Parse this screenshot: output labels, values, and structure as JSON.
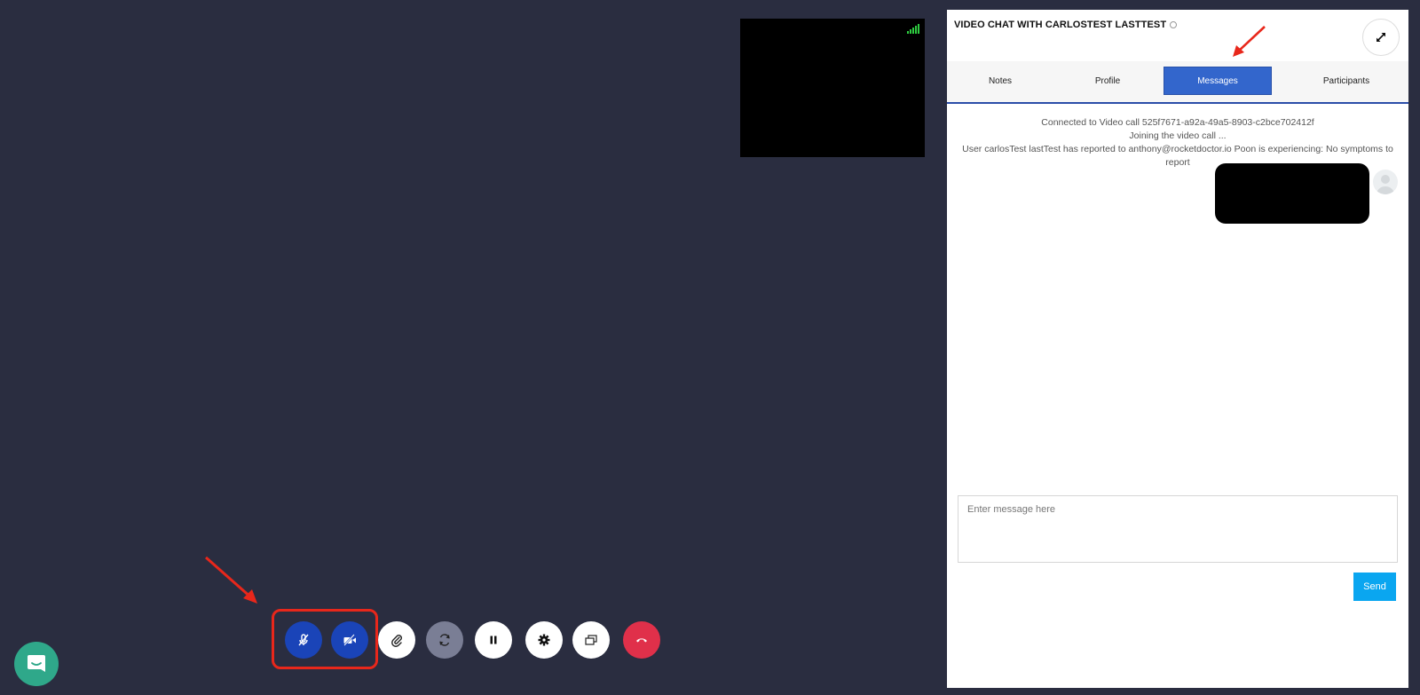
{
  "self_view": {
    "signal_icon": "signal-bars-icon"
  },
  "controls": [
    {
      "name": "mute-audio-button",
      "icon": "mic-off-icon",
      "style": "blue"
    },
    {
      "name": "mute-video-button",
      "icon": "video-off-icon",
      "style": "blue"
    },
    {
      "name": "attach-button",
      "icon": "paperclip-icon",
      "style": "white"
    },
    {
      "name": "switch-camera-button",
      "icon": "refresh-icon",
      "style": "gray"
    },
    {
      "name": "pause-button",
      "icon": "pause-icon",
      "style": "white"
    },
    {
      "name": "settings-button",
      "icon": "gear-icon",
      "style": "white"
    },
    {
      "name": "screen-share-button",
      "icon": "screen-share-icon",
      "style": "white"
    },
    {
      "name": "end-call-button",
      "icon": "phone-hangup-icon",
      "style": "red"
    }
  ],
  "panel": {
    "title": "VIDEO CHAT WITH CARLOSTEST LASTTEST",
    "tabs": [
      {
        "label": "Notes",
        "active": false
      },
      {
        "label": "Profile",
        "active": false
      },
      {
        "label": "Messages",
        "active": true
      },
      {
        "label": "Participants",
        "active": false
      }
    ],
    "messages": {
      "line1": "Connected to Video call 525f7671-a92a-49a5-8903-c2bce702412f",
      "line2": "Joining the video call ...",
      "line3": "User carlosTest lastTest has reported to anthony@rocketdoctor.io Poon is experiencing: No symptoms to report"
    },
    "input_placeholder": "Enter message here",
    "send_label": "Send"
  },
  "colors": {
    "background": "#2a2d40",
    "accent_blue": "#1a44b8",
    "active_tab": "#3366cc",
    "send_button": "#0aa6f0",
    "end_call": "#e0304a",
    "annotation_red": "#e8271b"
  }
}
